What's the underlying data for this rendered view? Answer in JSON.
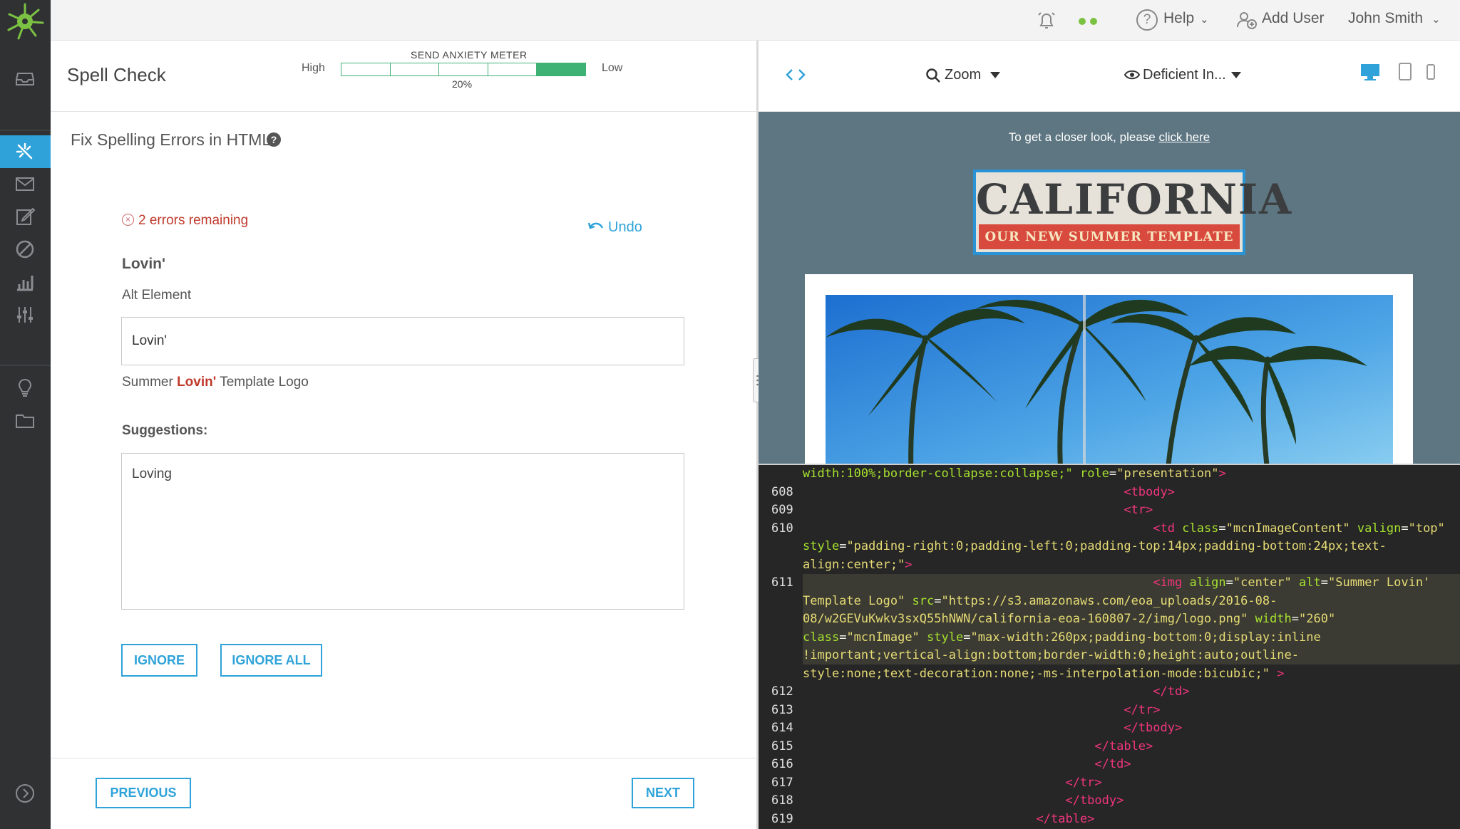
{
  "topbar": {
    "help": "Help",
    "add_user": "Add User",
    "user": "John Smith"
  },
  "header": {
    "title": "Spell Check",
    "meter_title": "SEND ANXIETY METER",
    "meter_high": "High",
    "meter_low": "Low",
    "meter_value": "20%",
    "meter_level": 0.2
  },
  "spellcheck": {
    "subtitle": "Fix Spelling Errors in HTML",
    "errors": "2 errors remaining",
    "undo": "Undo",
    "word": "Lovin'",
    "field_label": "Alt Element",
    "field_value": "Lovin'",
    "context_before": "Summer ",
    "context_word": "Lovin'",
    "context_after": " Template Logo",
    "suggestions_label": "Suggestions:",
    "suggestions": [
      "Loving"
    ],
    "ignore": "IGNORE",
    "ignore_all": "IGNORE ALL"
  },
  "footer": {
    "previous": "PREVIOUS",
    "next": "NEXT"
  },
  "preview_toolbar": {
    "zoom": "Zoom",
    "vision": "Deficient In..."
  },
  "preview": {
    "closer_text": "To get a closer look, please ",
    "closer_link": "click here",
    "logo_title": "CALIFORNIA",
    "logo_subtitle": "OUR NEW SUMMER TEMPLATE"
  },
  "code": {
    "line_numbers": [
      "608",
      "609",
      "610",
      "611",
      "612",
      "613",
      "614",
      "615",
      "616",
      "617",
      "618",
      "619"
    ]
  },
  "colors": {
    "accent": "#2fa3d9",
    "error": "#c0392b",
    "meter": "#3eb174",
    "nav_bg": "#2f3133",
    "preview_bg": "#5d7682",
    "code_bg": "#262626"
  }
}
